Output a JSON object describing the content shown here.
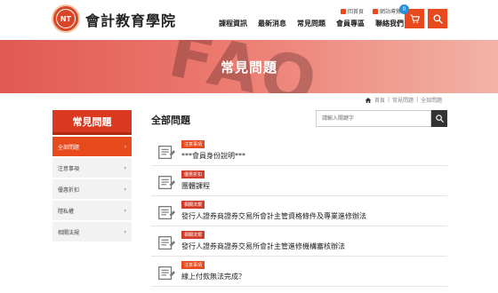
{
  "header": {
    "logo_text": "會計教育學院",
    "seal_text": "NT",
    "top_links": [
      "回首頁",
      "網站導覽"
    ],
    "nav": [
      "課程資訊",
      "最新消息",
      "常見問題",
      "會員專區",
      "聯絡我們"
    ],
    "cart_count": "0",
    "accent_color": "#e8491d"
  },
  "banner": {
    "title": "常見問題",
    "bg_text": "FAQ"
  },
  "breadcrumb": [
    "首頁",
    "常見問題",
    "全部問題"
  ],
  "sidebar": {
    "title": "常見問題",
    "items": [
      {
        "label": "全部問題",
        "active": true
      },
      {
        "label": "注意事項",
        "active": false
      },
      {
        "label": "優惠折扣",
        "active": false
      },
      {
        "label": "隱私權",
        "active": false
      },
      {
        "label": "相關法規",
        "active": false
      }
    ]
  },
  "content": {
    "title": "全部問題",
    "search_placeholder": "請輸入關鍵字"
  },
  "faq": [
    {
      "tag": "注意事項",
      "tag_color": "#e8491d",
      "question": "***會員身份說明***"
    },
    {
      "tag": "優惠折扣",
      "tag_color": "#d23b2a",
      "question": "團體課程"
    },
    {
      "tag": "相關法規",
      "tag_color": "#d23b2a",
      "question": "發行人證券商證券交易所會計主管資格條件及專業進修辦法"
    },
    {
      "tag": "相關法規",
      "tag_color": "#d23b2a",
      "question": "發行人證券商證券交易所會計主管進修機構審核辦法"
    },
    {
      "tag": "注意事項",
      "tag_color": "#e8491d",
      "question": "線上付款無法完成？"
    }
  ]
}
